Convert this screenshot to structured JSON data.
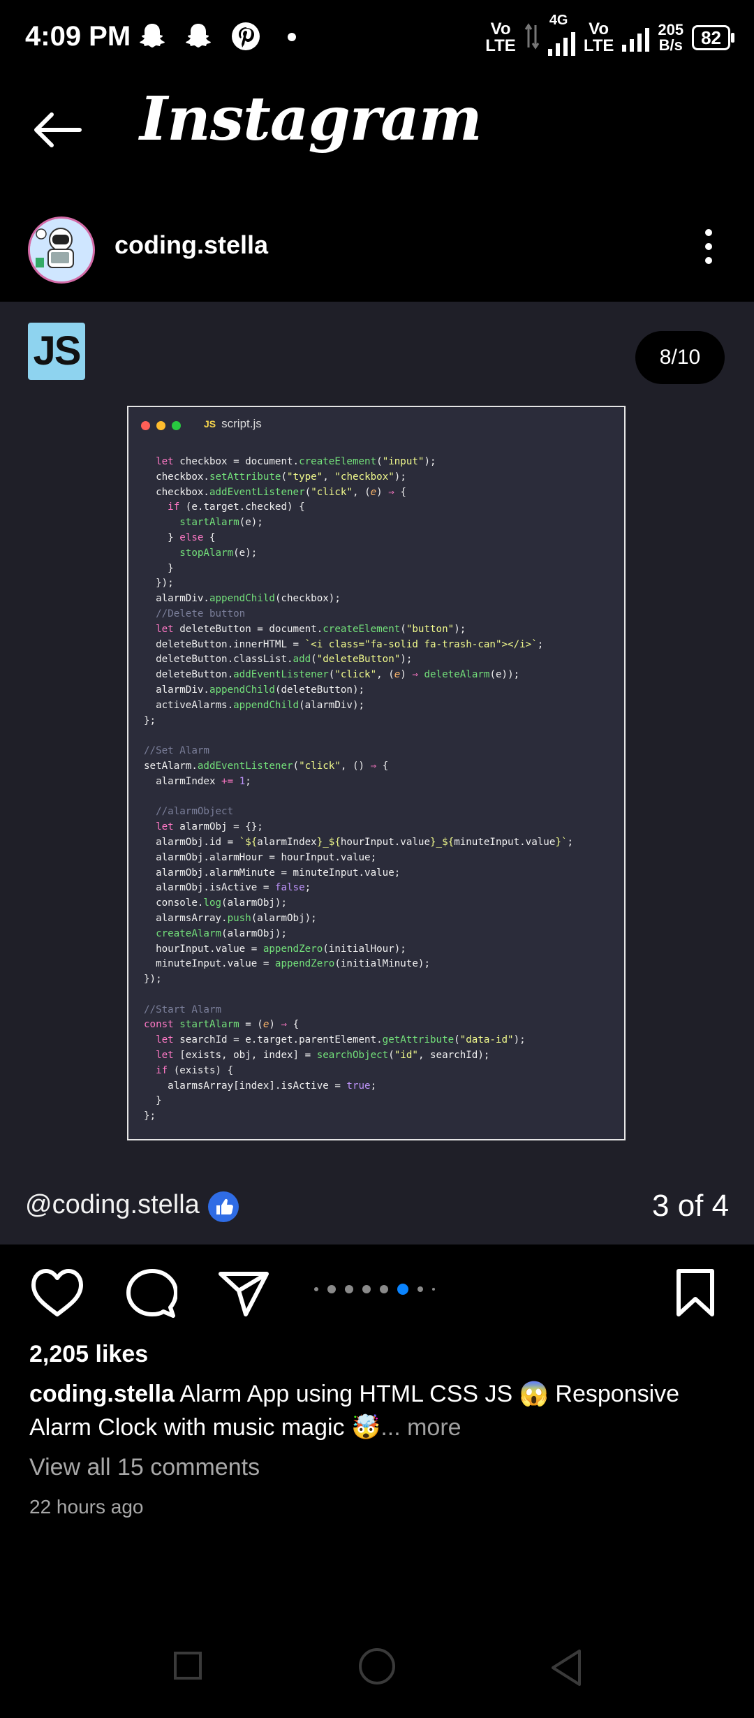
{
  "status_bar": {
    "time": "4:09 PM",
    "notification_icons": [
      "snapchat-icon",
      "snapchat-icon",
      "pinterest-icon",
      "dot-icon"
    ],
    "sim1": {
      "top": "Vo",
      "bottom": "LTE"
    },
    "network_type": "4G",
    "sim2": {
      "top": "Vo",
      "bottom": "LTE"
    },
    "speed": {
      "value": "205",
      "unit": "B/s"
    },
    "battery": "82"
  },
  "header": {
    "title": "Instagram",
    "back_icon": "back-arrow-icon"
  },
  "post": {
    "username": "coding.stella",
    "menu_icon": "more-vertical-icon",
    "badge": "JS",
    "slide_counter": "8/10",
    "code_file": "script.js",
    "code_file_badge": "JS",
    "code_lines": [
      [
        [
          "  let ",
          "kw"
        ],
        [
          "checkbox = document.",
          ""
        ],
        [
          "createElement",
          "fn"
        ],
        [
          "(",
          ""
        ],
        [
          "\"input\"",
          "st"
        ],
        [
          ");",
          ""
        ]
      ],
      [
        [
          "  checkbox.",
          ""
        ],
        [
          "setAttribute",
          "fn"
        ],
        [
          "(",
          ""
        ],
        [
          "\"type\"",
          "st"
        ],
        [
          ", ",
          ""
        ],
        [
          "\"checkbox\"",
          "st"
        ],
        [
          ");",
          ""
        ]
      ],
      [
        [
          "  checkbox.",
          ""
        ],
        [
          "addEventListener",
          "fn"
        ],
        [
          "(",
          ""
        ],
        [
          "\"click\"",
          "st"
        ],
        [
          ", (",
          ""
        ],
        [
          "e",
          "pa"
        ],
        [
          ") ",
          ""
        ],
        [
          "⇒",
          "kw"
        ],
        [
          " {",
          ""
        ]
      ],
      [
        [
          "    ",
          ""
        ],
        [
          "if",
          "kw"
        ],
        [
          " (e.target.checked) {",
          ""
        ]
      ],
      [
        [
          "      ",
          ""
        ],
        [
          "startAlarm",
          "fn"
        ],
        [
          "(e);",
          ""
        ]
      ],
      [
        [
          "    } ",
          ""
        ],
        [
          "else",
          "kw"
        ],
        [
          " {",
          ""
        ]
      ],
      [
        [
          "      ",
          ""
        ],
        [
          "stopAlarm",
          "fn"
        ],
        [
          "(e);",
          ""
        ]
      ],
      [
        [
          "    }",
          ""
        ]
      ],
      [
        [
          "  });",
          ""
        ]
      ],
      [
        [
          "  alarmDiv.",
          ""
        ],
        [
          "appendChild",
          "fn"
        ],
        [
          "(checkbox);",
          ""
        ]
      ],
      [
        [
          "  //Delete button",
          "cm"
        ]
      ],
      [
        [
          "  let ",
          "kw"
        ],
        [
          "deleteButton = document.",
          ""
        ],
        [
          "createElement",
          "fn"
        ],
        [
          "(",
          ""
        ],
        [
          "\"button\"",
          "st"
        ],
        [
          ");",
          ""
        ]
      ],
      [
        [
          "  deleteButton.innerHTML = ",
          ""
        ],
        [
          "`<i class=\"fa-solid fa-trash-can\"></i>`",
          "st"
        ],
        [
          ";",
          ""
        ]
      ],
      [
        [
          "  deleteButton.classList.",
          ""
        ],
        [
          "add",
          "fn"
        ],
        [
          "(",
          ""
        ],
        [
          "\"deleteButton\"",
          "st"
        ],
        [
          ");",
          ""
        ]
      ],
      [
        [
          "  deleteButton.",
          ""
        ],
        [
          "addEventListener",
          "fn"
        ],
        [
          "(",
          ""
        ],
        [
          "\"click\"",
          "st"
        ],
        [
          ", (",
          ""
        ],
        [
          "e",
          "pa"
        ],
        [
          ") ",
          ""
        ],
        [
          "⇒",
          "kw"
        ],
        [
          " ",
          ""
        ],
        [
          "deleteAlarm",
          "fn"
        ],
        [
          "(e));",
          ""
        ]
      ],
      [
        [
          "  alarmDiv.",
          ""
        ],
        [
          "appendChild",
          "fn"
        ],
        [
          "(deleteButton);",
          ""
        ]
      ],
      [
        [
          "  activeAlarms.",
          ""
        ],
        [
          "appendChild",
          "fn"
        ],
        [
          "(alarmDiv);",
          ""
        ]
      ],
      [
        [
          "};",
          ""
        ]
      ],
      [
        [
          "",
          ""
        ]
      ],
      [
        [
          "//Set Alarm",
          "cm"
        ]
      ],
      [
        [
          "setAlarm.",
          ""
        ],
        [
          "addEventListener",
          "fn"
        ],
        [
          "(",
          ""
        ],
        [
          "\"click\"",
          "st"
        ],
        [
          ", () ",
          ""
        ],
        [
          "⇒",
          "kw"
        ],
        [
          " {",
          ""
        ]
      ],
      [
        [
          "  alarmIndex ",
          ""
        ],
        [
          "+=",
          "kw"
        ],
        [
          " ",
          ""
        ],
        [
          "1",
          "nu"
        ],
        [
          ";",
          ""
        ]
      ],
      [
        [
          "",
          ""
        ]
      ],
      [
        [
          "  //alarmObject",
          "cm"
        ]
      ],
      [
        [
          "  let ",
          "kw"
        ],
        [
          "alarmObj = {};",
          ""
        ]
      ],
      [
        [
          "  alarmObj.id = ",
          ""
        ],
        [
          "`${",
          "st"
        ],
        [
          "alarmIndex",
          ""
        ],
        [
          "}_${",
          "st"
        ],
        [
          "hourInput.value",
          ""
        ],
        [
          "}_${",
          "st"
        ],
        [
          "minuteInput.value",
          ""
        ],
        [
          "}`",
          "st"
        ],
        [
          ";",
          ""
        ]
      ],
      [
        [
          "  alarmObj.alarmHour = hourInput.value;",
          ""
        ]
      ],
      [
        [
          "  alarmObj.alarmMinute = minuteInput.value;",
          ""
        ]
      ],
      [
        [
          "  alarmObj.isActive = ",
          ""
        ],
        [
          "false",
          "nu"
        ],
        [
          ";",
          ""
        ]
      ],
      [
        [
          "  console.",
          ""
        ],
        [
          "log",
          "fn"
        ],
        [
          "(alarmObj);",
          ""
        ]
      ],
      [
        [
          "  alarmsArray.",
          ""
        ],
        [
          "push",
          "fn"
        ],
        [
          "(alarmObj);",
          ""
        ]
      ],
      [
        [
          "  ",
          ""
        ],
        [
          "createAlarm",
          "fn"
        ],
        [
          "(alarmObj);",
          ""
        ]
      ],
      [
        [
          "  hourInput.value = ",
          ""
        ],
        [
          "appendZero",
          "fn"
        ],
        [
          "(initialHour);",
          ""
        ]
      ],
      [
        [
          "  minuteInput.value = ",
          ""
        ],
        [
          "appendZero",
          "fn"
        ],
        [
          "(initialMinute);",
          ""
        ]
      ],
      [
        [
          "});",
          ""
        ]
      ],
      [
        [
          "",
          ""
        ]
      ],
      [
        [
          "//Start Alarm",
          "cm"
        ]
      ],
      [
        [
          "const ",
          "kw"
        ],
        [
          "startAlarm",
          "fn"
        ],
        [
          " = (",
          ""
        ],
        [
          "e",
          "pa"
        ],
        [
          ") ",
          ""
        ],
        [
          "⇒",
          "kw"
        ],
        [
          " {",
          ""
        ]
      ],
      [
        [
          "  let ",
          "kw"
        ],
        [
          "searchId = e.target.parentElement.",
          ""
        ],
        [
          "getAttribute",
          "fn"
        ],
        [
          "(",
          ""
        ],
        [
          "\"data-id\"",
          "st"
        ],
        [
          ");",
          ""
        ]
      ],
      [
        [
          "  let ",
          "kw"
        ],
        [
          "[exists, obj, index] = ",
          ""
        ],
        [
          "searchObject",
          "fn"
        ],
        [
          "(",
          ""
        ],
        [
          "\"id\"",
          "st"
        ],
        [
          ", searchId);",
          ""
        ]
      ],
      [
        [
          "  if",
          "kw"
        ],
        [
          " (exists) {",
          ""
        ]
      ],
      [
        [
          "    alarmsArray[index].isActive = ",
          ""
        ],
        [
          "true",
          "nu"
        ],
        [
          ";",
          ""
        ]
      ],
      [
        [
          "  }",
          ""
        ]
      ],
      [
        [
          "};",
          ""
        ]
      ]
    ],
    "watermark": "@coding.stella",
    "page_of": "3 of 4",
    "carousel": {
      "count": 8,
      "active_index": 5
    },
    "likes": "2,205 likes",
    "caption_user": "coding.stella",
    "caption_text": " Alarm App using HTML CSS JS 😱 Responsive Alarm Clock with music magic 🤯",
    "caption_more": "... more",
    "comments_link": "View all 15 comments",
    "timestamp": "22 hours ago"
  },
  "actions": [
    "like-heart-icon",
    "comment-icon",
    "share-send-icon",
    "save-bookmark-icon"
  ],
  "nav": [
    "recent-apps-icon",
    "home-icon",
    "back-icon"
  ],
  "colors": {
    "background": "#000000",
    "media_bg": "#1f1f28",
    "code_bg": "#2b2c3a",
    "accent_blue": "#0a84ff",
    "js_badge": "#8ed3ef"
  }
}
